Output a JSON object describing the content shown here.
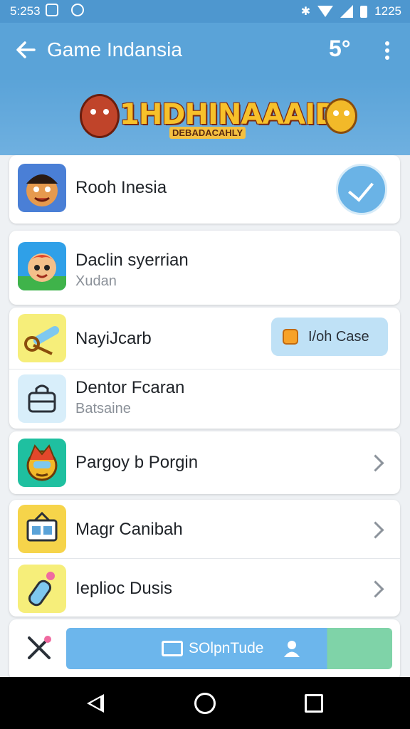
{
  "status_bar": {
    "time": "5:253",
    "battery_text": "1225"
  },
  "appbar": {
    "title": "Game Indansia",
    "level": "5°"
  },
  "banner": {
    "logo_text": "1HDHINAAAID",
    "subtitle": "DEBADACAHLY"
  },
  "items": [
    {
      "label": "Rooh Inesia",
      "icon": "warrior-face-icon",
      "action": "check"
    },
    {
      "label": "Daclin syerrian",
      "sublabel": "Xudan",
      "icon": "red-hair-character-icon"
    },
    {
      "label": "NayiJcarb",
      "icon": "telescope-icon",
      "action_label": "I/oh Case"
    },
    {
      "label": "Dentor Fcaran",
      "sublabel": "Batsaine",
      "icon": "bag-icon"
    },
    {
      "label": "Pargoy b Porgin",
      "icon": "robot-character-icon"
    },
    {
      "label": "Magr Canibah",
      "icon": "calendar-box-icon"
    },
    {
      "label": "Ieplioc Dusis",
      "icon": "potion-bottle-icon"
    }
  ],
  "bottom_bar": {
    "button_label": "SOlpnTude",
    "tool_icon": "crossed-tools-icon"
  },
  "colors": {
    "primary": "#5aa3d8",
    "accent_green": "#7fd3a8",
    "text": "#1f2328"
  }
}
